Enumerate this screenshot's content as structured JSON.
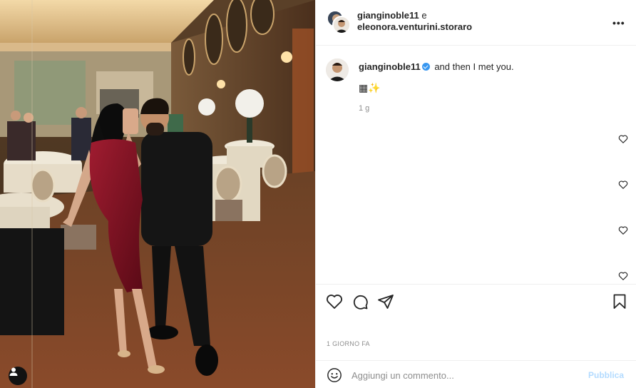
{
  "post": {
    "header": {
      "user1": "gianginoble11",
      "conjunction": "e",
      "user2": "eleonora.venturini.storaro",
      "more_icon": "more-horizontal-icon"
    },
    "caption": {
      "username": "gianginoble11",
      "text": "and then I met you.",
      "emoji": "▦✨",
      "time": "1 g"
    },
    "time_ago": "1 GIORNO FA",
    "comment": {
      "placeholder": "Aggiungi un commento...",
      "publish_label": "Pubblica"
    },
    "colors": {
      "verified": "#3897f0",
      "publish_disabled": "#b3dbff",
      "dress": "#7a1222"
    }
  }
}
